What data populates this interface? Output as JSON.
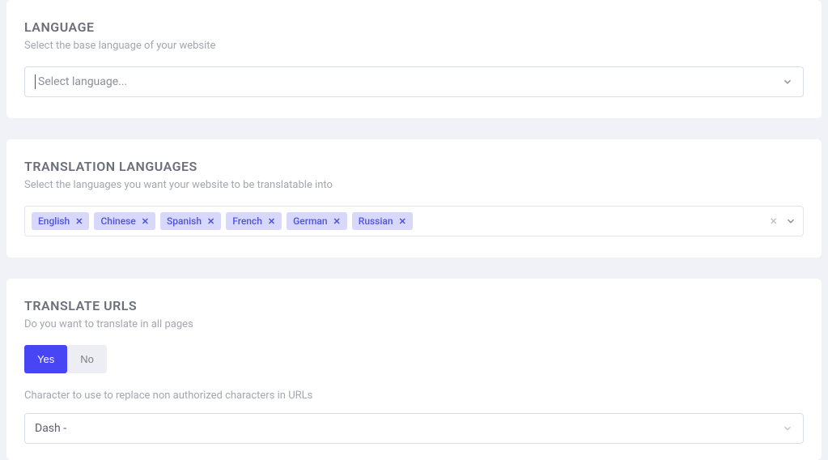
{
  "language": {
    "title": "LANGUAGE",
    "desc": "Select the base language of your website",
    "placeholder": "Select language..."
  },
  "translation": {
    "title": "TRANSLATION LANGUAGES",
    "desc": "Select the languages you want your website to be translatable into",
    "tags": [
      "English",
      "Chinese",
      "Spanish",
      "French",
      "German",
      "Russian"
    ]
  },
  "urls": {
    "title": "TRANSLATE URLS",
    "desc": "Do you want to translate in all pages",
    "yes": "Yes",
    "no": "No",
    "char_label": "Character to use to replace non authorized characters in URLs",
    "char_value": "Dash -"
  }
}
